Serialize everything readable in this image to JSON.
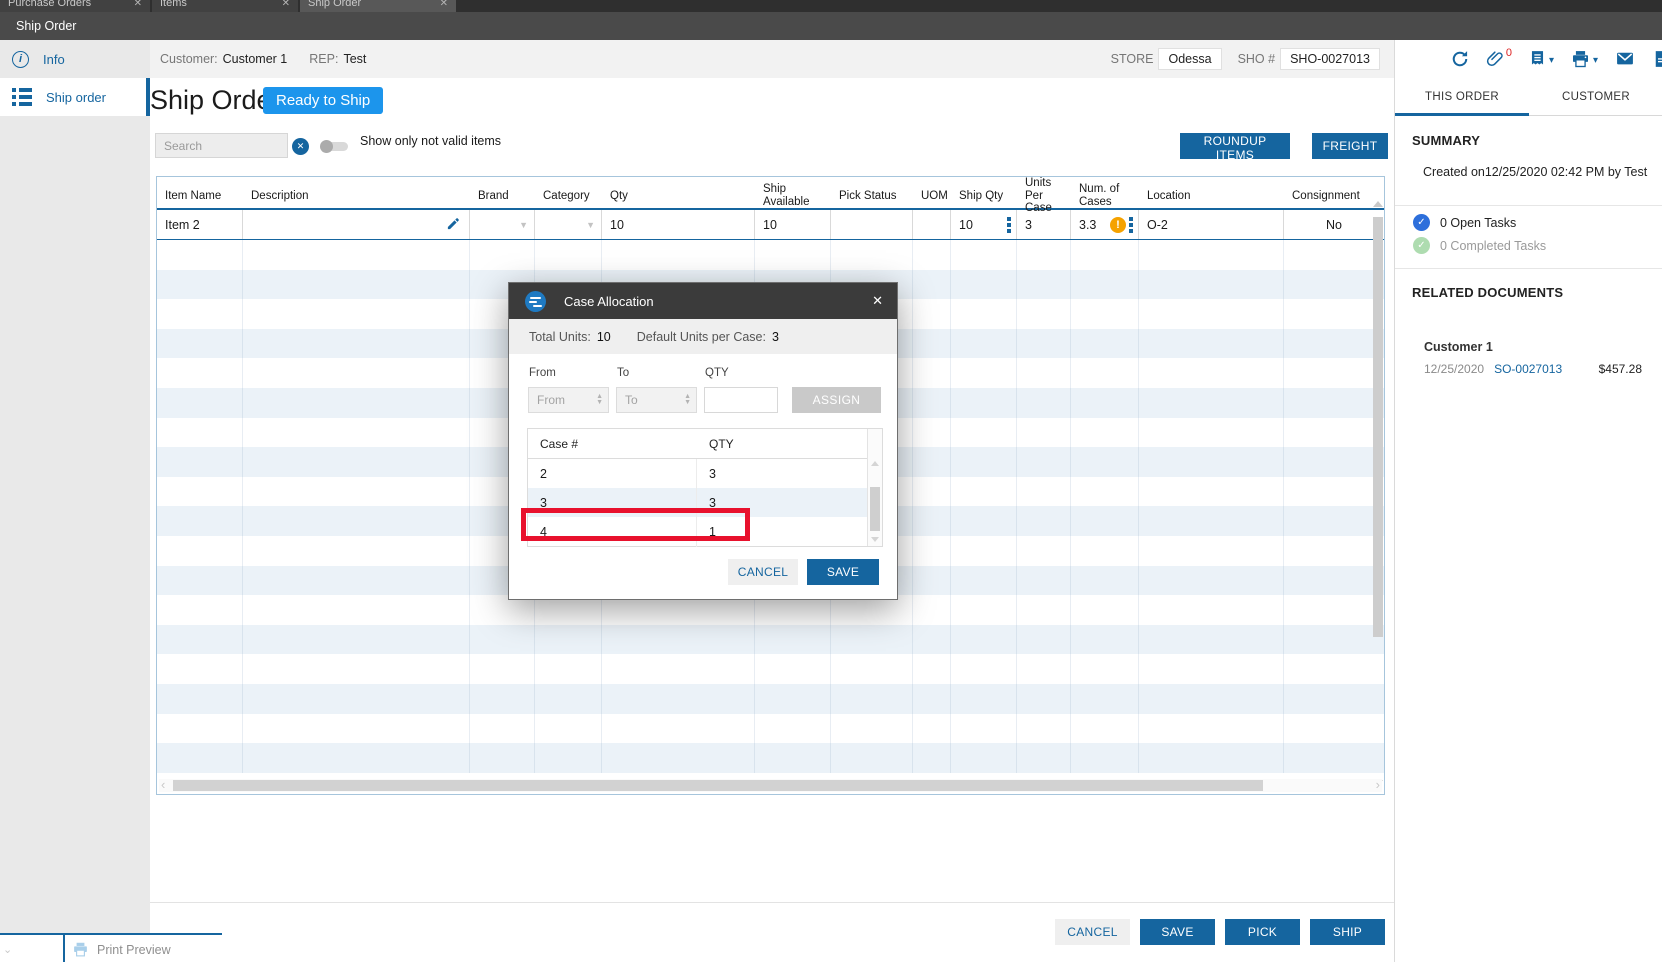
{
  "colors": {
    "accent": "#15659f",
    "badge_blue": "#1c95ec",
    "warning_orange": "#f5a200",
    "annotation_red": "#e8112d",
    "alt_row_blue": "#ebf2f8",
    "titlebar_gray": "#4a4a4a"
  },
  "icons": {
    "close": "✕",
    "minimize": "—",
    "caret_down": "▾",
    "dropdown_arrow": "▼",
    "spinner_up": "▲",
    "spinner_down": "▼",
    "chevron_left": "‹",
    "chevron_right": "›",
    "chevron_down": "⌄",
    "check": "✓",
    "warning": "!",
    "info": "i"
  },
  "tab_strip": {
    "tabs": [
      {
        "label": "Purchase Orders"
      },
      {
        "label": "Items"
      },
      {
        "label": "Ship Order"
      }
    ]
  },
  "window": {
    "title": "Ship Order"
  },
  "sidebar": {
    "items": [
      {
        "label": "Info"
      },
      {
        "label": "Ship order"
      }
    ]
  },
  "header": {
    "customer_label": "Customer:",
    "customer_value": "Customer 1",
    "rep_label": "REP:",
    "rep_value": "Test",
    "store_label": "STORE",
    "store_value": "Odessa",
    "sho_label": "SHO #",
    "sho_value": "SHO-0027013"
  },
  "toolbar": {
    "attachment_count": "0"
  },
  "page": {
    "title": "Ship Order",
    "status_badge": "Ready to Ship",
    "search_placeholder": "Search",
    "filter_toggle_label": "Show only not valid items",
    "roundup_button": "ROUNDUP ITEMS",
    "freight_button": "FREIGHT"
  },
  "items_table": {
    "columns": [
      "Item Name",
      "Description",
      "Brand",
      "Category",
      "Qty",
      "Ship Available",
      "Pick Status",
      "UOM",
      "Ship Qty",
      "Units Per Case",
      "Num. of Cases",
      "Location",
      "Consignment"
    ],
    "filler_row_count": 18,
    "row": {
      "item_name": "Item 2",
      "qty": "10",
      "ship_available": "10",
      "ship_qty": "10",
      "units_per_case": "3",
      "num_of_cases": "3.3",
      "location": "O-2",
      "consignment": "No"
    }
  },
  "case_allocation_modal": {
    "title": "Case Allocation",
    "total_units_label": "Total Units:",
    "total_units_value": "10",
    "default_units_label": "Default Units per Case:",
    "default_units_value": "3",
    "from_label": "From",
    "to_label": "To",
    "qty_label": "QTY",
    "from_placeholder": "From",
    "to_placeholder": "To",
    "assign_button": "ASSIGN",
    "table": {
      "columns": [
        "Case #",
        "QTY"
      ],
      "rows": [
        {
          "case": "2",
          "qty": "3"
        },
        {
          "case": "3",
          "qty": "3"
        },
        {
          "case": "4",
          "qty": "1"
        }
      ]
    },
    "cancel_button": "CANCEL",
    "save_button": "SAVE"
  },
  "right_panel": {
    "tabs": [
      {
        "label": "THIS ORDER"
      },
      {
        "label": "CUSTOMER"
      }
    ],
    "summary": {
      "heading": "SUMMARY",
      "created_line": "Created on12/25/2020 02:42 PM by Test",
      "open_tasks": "0 Open Tasks",
      "completed_tasks": "0 Completed Tasks"
    },
    "related_documents": {
      "heading": "RELATED DOCUMENTS",
      "customer": "Customer 1",
      "date": "12/25/2020",
      "document_number": "SO-0027013",
      "amount": "$457.28"
    }
  },
  "footer": {
    "cancel_button": "CANCEL",
    "save_button": "SAVE",
    "pick_button": "PICK",
    "ship_button": "SHIP",
    "print_preview": "Print Preview"
  }
}
